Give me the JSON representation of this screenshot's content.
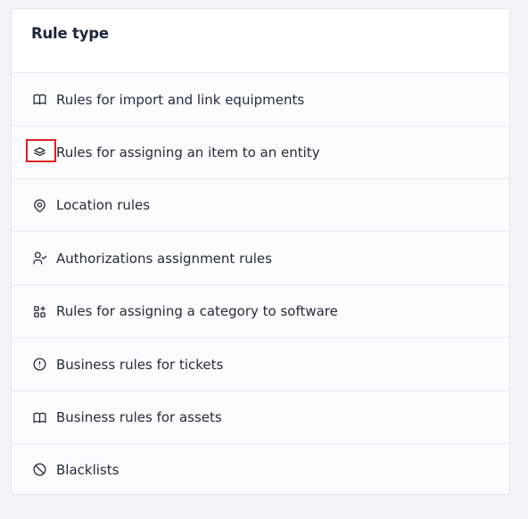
{
  "card": {
    "title": "Rule type"
  },
  "items": [
    {
      "label": "Rules for import and link equipments",
      "icon": "book-icon"
    },
    {
      "label": "Rules for assigning an item to an entity",
      "icon": "layers-icon"
    },
    {
      "label": "Location rules",
      "icon": "map-pin-icon"
    },
    {
      "label": "Authorizations assignment rules",
      "icon": "user-check-icon"
    },
    {
      "label": "Rules for assigning a category to software",
      "icon": "apps-plus-icon"
    },
    {
      "label": "Business rules for tickets",
      "icon": "alert-circle-icon"
    },
    {
      "label": "Business rules for assets",
      "icon": "book-icon"
    },
    {
      "label": "Blacklists",
      "icon": "ban-icon"
    }
  ],
  "colors": {
    "highlight": "#e11d24",
    "text": "#232d3d",
    "background": "#f3f4f8"
  }
}
